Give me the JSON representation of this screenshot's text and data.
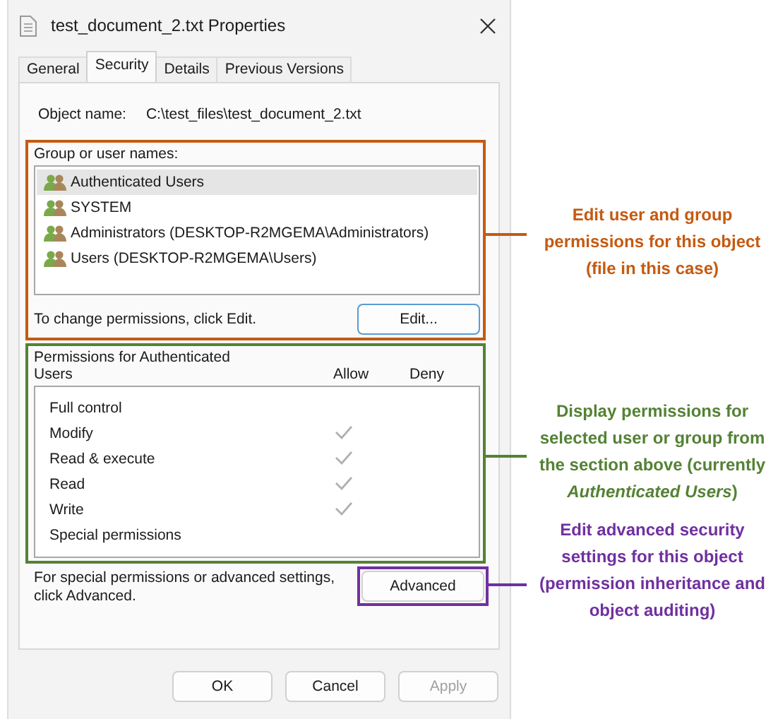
{
  "window": {
    "title": "test_document_2.txt Properties"
  },
  "tabs": [
    {
      "label": "General",
      "selected": false
    },
    {
      "label": "Security",
      "selected": true
    },
    {
      "label": "Details",
      "selected": false
    },
    {
      "label": "Previous Versions",
      "selected": false
    }
  ],
  "object_name": {
    "label": "Object name:",
    "value": "C:\\test_files\\test_document_2.txt"
  },
  "groups": {
    "label": "Group or user names:",
    "items": [
      {
        "name": "Authenticated Users",
        "selected": true
      },
      {
        "name": "SYSTEM",
        "selected": false
      },
      {
        "name": "Administrators (DESKTOP-R2MGEMA\\Administrators)",
        "selected": false
      },
      {
        "name": "Users (DESKTOP-R2MGEMA\\Users)",
        "selected": false
      }
    ],
    "note": "To change permissions, click Edit.",
    "edit_button": "Edit..."
  },
  "permissions": {
    "heading": "Permissions for Authenticated Users",
    "columns": [
      "Allow",
      "Deny"
    ],
    "rows": [
      {
        "name": "Full control",
        "allow": false
      },
      {
        "name": "Modify",
        "allow": true
      },
      {
        "name": "Read & execute",
        "allow": true
      },
      {
        "name": "Read",
        "allow": true
      },
      {
        "name": "Write",
        "allow": true
      },
      {
        "name": "Special permissions",
        "allow": false
      }
    ]
  },
  "advanced": {
    "note": "For special permissions or advanced settings, click Advanced.",
    "button": "Advanced"
  },
  "buttons": [
    {
      "label": "OK",
      "disabled": false
    },
    {
      "label": "Cancel",
      "disabled": false
    },
    {
      "label": "Apply",
      "disabled": true
    }
  ],
  "annotations": [
    {
      "text": "Edit user and group permissions for this object (file in this case)",
      "color": "#c55a11"
    },
    {
      "text": "Display permissions for selected user or group from the section above (currently *Authenticated Users*)",
      "color": "#548235"
    },
    {
      "text": "Edit advanced security settings for this object (permission inheritance and object auditing)",
      "color": "#7030a0"
    }
  ]
}
